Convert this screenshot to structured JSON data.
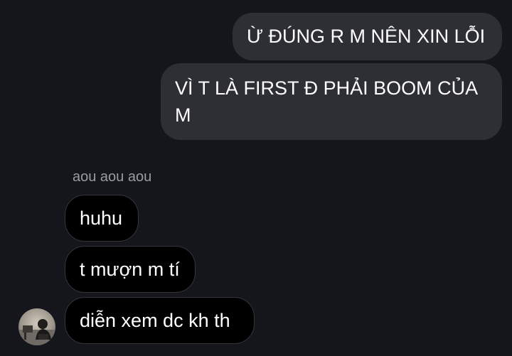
{
  "conversation": {
    "outgoing": [
      {
        "text": "Ừ ĐÚNG R M NÊN XIN LỖI"
      },
      {
        "text": "VÌ T LÀ FIRST Đ PHẢI BOOM CỦA M"
      }
    ],
    "sender_name": "aou aou aou",
    "incoming": [
      {
        "text": "huhu"
      },
      {
        "text": "t mượn m tí"
      },
      {
        "text": "diễn xem dc kh th"
      }
    ],
    "avatar_icon": "user-avatar-photo"
  }
}
